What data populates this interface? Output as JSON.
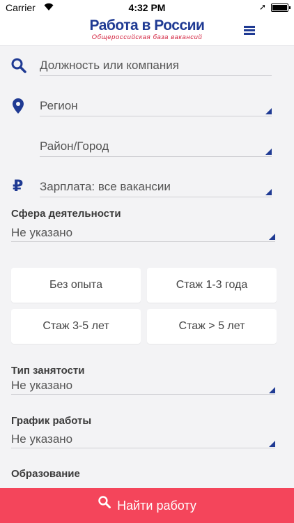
{
  "status_bar": {
    "carrier": "Carrier",
    "time": "4:32 PM",
    "location_icon": "location-arrow-icon",
    "battery_icon": "battery-icon"
  },
  "header": {
    "logo_main": "Работа в России",
    "logo_sub": "Общероссийская база вакансий",
    "menu_icon": "hamburger-menu-icon"
  },
  "search": {
    "placeholder": "Должность или компания"
  },
  "region": {
    "value": "Регион"
  },
  "city": {
    "value": "Район/Город"
  },
  "salary": {
    "value": "Зарплата: все вакансии"
  },
  "sphere": {
    "label": "Сфера деятельности",
    "value": "Не указано"
  },
  "experience": [
    {
      "label": "Без опыта"
    },
    {
      "label": "Стаж 1-3 года"
    },
    {
      "label": "Стаж 3-5 лет"
    },
    {
      "label": "Стаж > 5 лет"
    }
  ],
  "employment": {
    "label": "Тип занятости",
    "value": "Не указано"
  },
  "schedule": {
    "label": "График работы",
    "value": "Не указано"
  },
  "education": {
    "label": "Образование"
  },
  "find_button": {
    "label": "Найти работу"
  },
  "colors": {
    "brand_blue": "#1f3a93",
    "accent_red": "#f4455b",
    "logo_sub_red": "#d21f3c"
  }
}
